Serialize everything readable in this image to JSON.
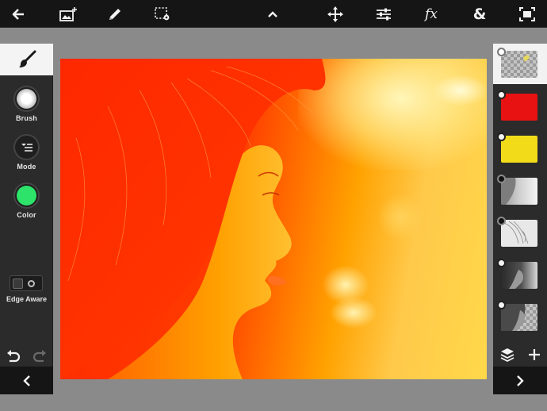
{
  "app": {
    "canvas_colors": {
      "primary_red": "#ff2a00",
      "primary_orange": "#ff8a00",
      "primary_yellow": "#ffd84a"
    }
  },
  "toolbar": {
    "items": [
      {
        "name": "back",
        "icon": "arrow-left-icon"
      },
      {
        "name": "add-image",
        "icon": "add-image-icon"
      },
      {
        "name": "brush",
        "icon": "pencil-icon"
      },
      {
        "name": "selection",
        "icon": "selection-settings-icon"
      },
      {
        "name": "collapse",
        "icon": "chevron-up-icon"
      },
      {
        "name": "move",
        "icon": "move-arrows-icon"
      },
      {
        "name": "adjustments",
        "icon": "sliders-icon"
      },
      {
        "name": "effects",
        "icon": "fx-icon",
        "label": "fx"
      },
      {
        "name": "blend",
        "icon": "ampersand-icon",
        "label": "&"
      },
      {
        "name": "fit-screen",
        "icon": "fit-screen-icon"
      }
    ]
  },
  "left_panel": {
    "active_tool_icon": "paintbrush-icon",
    "brush": {
      "label": "Brush",
      "icon": "soft-brush-icon"
    },
    "mode": {
      "label": "Mode",
      "icon": "mode-menu-icon"
    },
    "color": {
      "label": "Color",
      "value": "#2de36a"
    },
    "edge_aware": {
      "label": "Edge Aware",
      "enabled": false
    },
    "undo_icon": "undo-icon",
    "redo_icon": "redo-icon",
    "nav_icon": "chevron-left-icon"
  },
  "layers_panel": {
    "layers": [
      {
        "type": "transparent-sketch",
        "selected": true,
        "visible": true
      },
      {
        "type": "solid",
        "color": "#e81212",
        "visible": true
      },
      {
        "type": "solid",
        "color": "#f2dc1a",
        "visible": true
      },
      {
        "type": "photo-mask",
        "visible": false
      },
      {
        "type": "sketch",
        "visible": false
      },
      {
        "type": "photo-dark",
        "visible": true
      },
      {
        "type": "photo-mask-dark",
        "visible": true
      }
    ],
    "layers_icon": "layers-icon",
    "add_icon": "plus-icon",
    "nav_icon": "chevron-right-icon"
  }
}
